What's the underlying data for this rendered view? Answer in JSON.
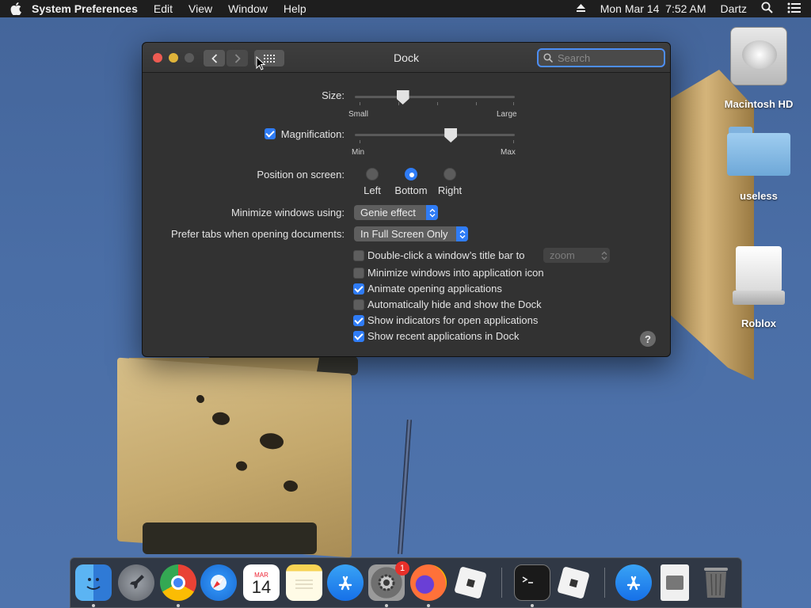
{
  "menubar": {
    "app_name": "System Preferences",
    "menus": [
      "Edit",
      "View",
      "Window",
      "Help"
    ],
    "datetime": "Mon Mar 14  7:52 AM",
    "user": "Dartz",
    "icons": [
      "apple-icon",
      "eject-icon",
      "spotlight-search-icon",
      "control-center-icon"
    ]
  },
  "desktop": {
    "icons": [
      {
        "label": "Macintosh HD",
        "type": "hard-drive-icon"
      },
      {
        "label": "useless",
        "type": "folder-icon"
      },
      {
        "label": "Roblox",
        "type": "disk-image-icon"
      }
    ]
  },
  "window": {
    "title": "Dock",
    "search_placeholder": "Search",
    "size": {
      "label": "Size:",
      "min_label": "Small",
      "max_label": "Large",
      "value": 0.3
    },
    "magnification": {
      "label": "Magnification:",
      "checked": true,
      "min_label": "Min",
      "max_label": "Max",
      "value": 0.6
    },
    "position": {
      "label": "Position on screen:",
      "options": [
        "Left",
        "Bottom",
        "Right"
      ],
      "selected": "Bottom"
    },
    "minimize_using": {
      "label": "Minimize windows using:",
      "value": "Genie effect"
    },
    "prefer_tabs": {
      "label": "Prefer tabs when opening documents:",
      "value": "In Full Screen Only"
    },
    "double_click": {
      "label": "Double-click a window’s title bar to",
      "value": "zoom",
      "checked": false
    },
    "checkboxes": [
      {
        "label": "Minimize windows into application icon",
        "checked": false
      },
      {
        "label": "Animate opening applications",
        "checked": true
      },
      {
        "label": "Automatically hide and show the Dock",
        "checked": false
      },
      {
        "label": "Show indicators for open applications",
        "checked": true
      },
      {
        "label": "Show recent applications in Dock",
        "checked": true
      }
    ],
    "help": "?"
  },
  "dock": {
    "apps": [
      {
        "name": "finder-icon",
        "running": true
      },
      {
        "name": "launchpad-icon",
        "running": false
      },
      {
        "name": "chrome-icon",
        "running": true
      },
      {
        "name": "safari-icon",
        "running": false
      },
      {
        "name": "calendar-icon",
        "running": false,
        "month": "MAR",
        "day": "14"
      },
      {
        "name": "notes-icon",
        "running": false
      },
      {
        "name": "app-store-icon",
        "running": false
      },
      {
        "name": "system-preferences-icon",
        "running": true,
        "badge": "1"
      },
      {
        "name": "firefox-icon",
        "running": true
      },
      {
        "name": "roblox-icon",
        "running": false
      },
      {
        "name": "terminal-icon",
        "running": true
      },
      {
        "name": "roblox-studio-icon",
        "running": false
      },
      {
        "name": "app-store-download-icon",
        "running": false
      },
      {
        "name": "preview-document-icon",
        "running": false
      },
      {
        "name": "trash-icon",
        "running": false
      }
    ]
  }
}
